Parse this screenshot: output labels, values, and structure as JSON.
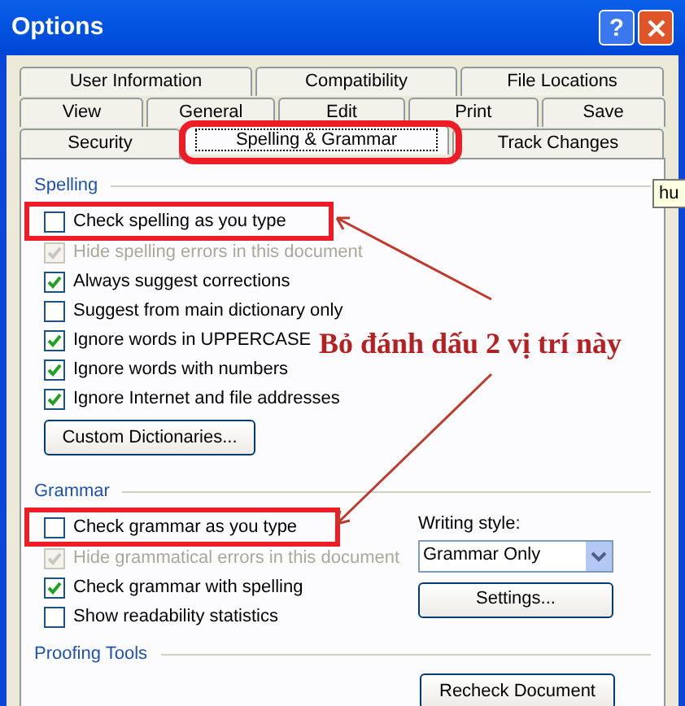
{
  "window": {
    "title": "Options",
    "help_button": "?"
  },
  "tab_rows": [
    [
      {
        "label": "User Information",
        "selected": false
      },
      {
        "label": "Compatibility",
        "selected": false
      },
      {
        "label": "File Locations",
        "selected": false
      }
    ],
    [
      {
        "label": "View",
        "selected": false
      },
      {
        "label": "General",
        "selected": false
      },
      {
        "label": "Edit",
        "selected": false
      },
      {
        "label": "Print",
        "selected": false
      },
      {
        "label": "Save",
        "selected": false
      }
    ],
    [
      {
        "label": "Security",
        "selected": false
      },
      {
        "label": "Spelling & Grammar",
        "selected": true
      },
      {
        "label": "Track Changes",
        "selected": false
      }
    ]
  ],
  "tooltip": "hu",
  "spelling": {
    "heading": "Spelling",
    "options": [
      {
        "label": "Check spelling as you type",
        "checked": false,
        "disabled": false
      },
      {
        "label": "Hide spelling errors in this document",
        "checked": true,
        "disabled": true
      },
      {
        "label": "Always suggest corrections",
        "checked": true,
        "disabled": false
      },
      {
        "label": "Suggest from main dictionary only",
        "checked": false,
        "disabled": false
      },
      {
        "label": "Ignore words in UPPERCASE",
        "checked": true,
        "disabled": false
      },
      {
        "label": "Ignore words with numbers",
        "checked": true,
        "disabled": false
      },
      {
        "label": "Ignore Internet and file addresses",
        "checked": true,
        "disabled": false
      }
    ],
    "button": "Custom Dictionaries..."
  },
  "grammar": {
    "heading": "Grammar",
    "options": [
      {
        "label": "Check grammar as you type",
        "checked": false,
        "disabled": false
      },
      {
        "label": "Hide grammatical errors in this document",
        "checked": true,
        "disabled": true
      },
      {
        "label": "Check grammar with spelling",
        "checked": true,
        "disabled": false
      },
      {
        "label": "Show readability statistics",
        "checked": false,
        "disabled": false
      }
    ],
    "writing_style": {
      "label": "Writing style:",
      "value": "Grammar Only"
    },
    "button": "Settings..."
  },
  "proofing_tools": {
    "heading": "Proofing Tools",
    "button": "Recheck Document"
  },
  "annotation": {
    "text": "Bỏ đánh dấu 2 vị trí này"
  }
}
